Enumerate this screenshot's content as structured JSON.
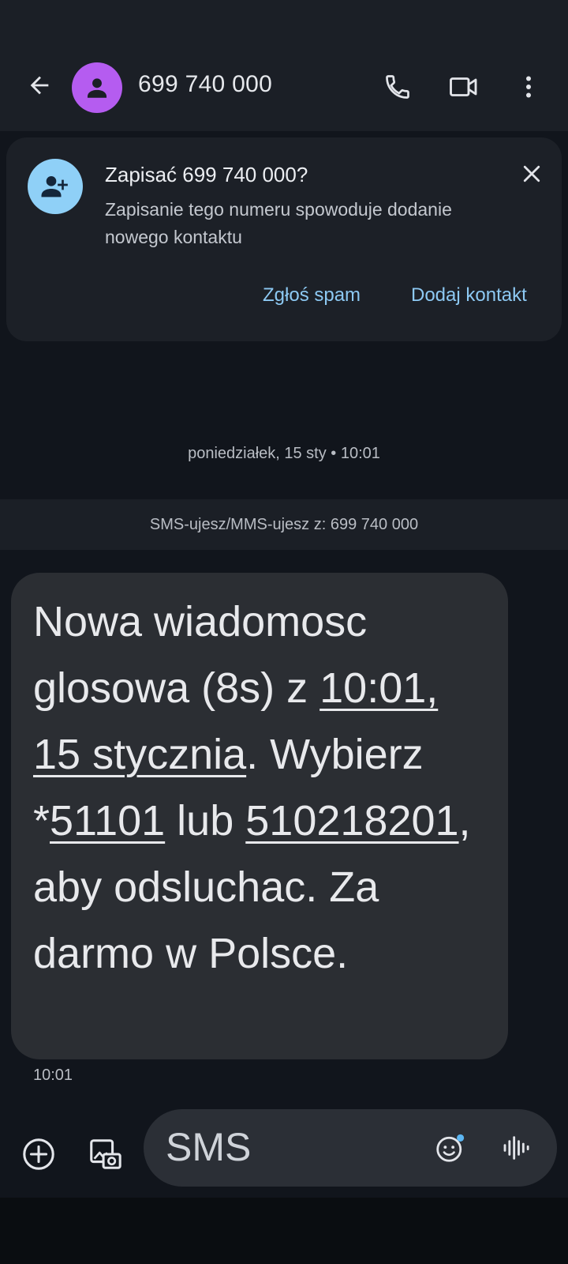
{
  "header": {
    "title": "699 740 000",
    "back_icon": "arrow-left-icon",
    "avatar_icon": "person-icon",
    "avatar_color": "#b55cf0",
    "call_icon": "phone-icon",
    "video_icon": "video-camera-icon",
    "more_icon": "more-vert-icon"
  },
  "contact_card": {
    "icon": "person-add-icon",
    "title": "Zapisać 699 740 000?",
    "description": "Zapisanie tego numeru spowoduje dodanie nowego kontaktu",
    "close_icon": "close-icon",
    "spam_label": "Zgłoś spam",
    "add_label": "Dodaj kontakt",
    "accent_color": "#8dc9f3"
  },
  "conversation": {
    "date_separator": "poniedziałek, 15 sty • 10:01",
    "via_label": "SMS-ujesz/MMS-ujesz z: 699 740 000",
    "message": {
      "segments": [
        {
          "text": "Nowa wiadomosc glosowa (8s) z ",
          "link": false
        },
        {
          "text": "10:01, 15 stycznia",
          "link": true
        },
        {
          "text": ". Wybierz *",
          "link": false
        },
        {
          "text": "51101",
          "link": true
        },
        {
          "text": " lub ",
          "link": false
        },
        {
          "text": "510218201",
          "link": true
        },
        {
          "text": ", aby odsluchac. Za darmo w Polsce.",
          "link": false
        }
      ],
      "time": "10:01"
    }
  },
  "composer": {
    "placeholder": "SMS",
    "add_icon": "add-circle-icon",
    "gallery_icon": "gallery-icon",
    "emoji_icon": "emoji-icon",
    "voice_icon": "voice-waveform-icon"
  }
}
